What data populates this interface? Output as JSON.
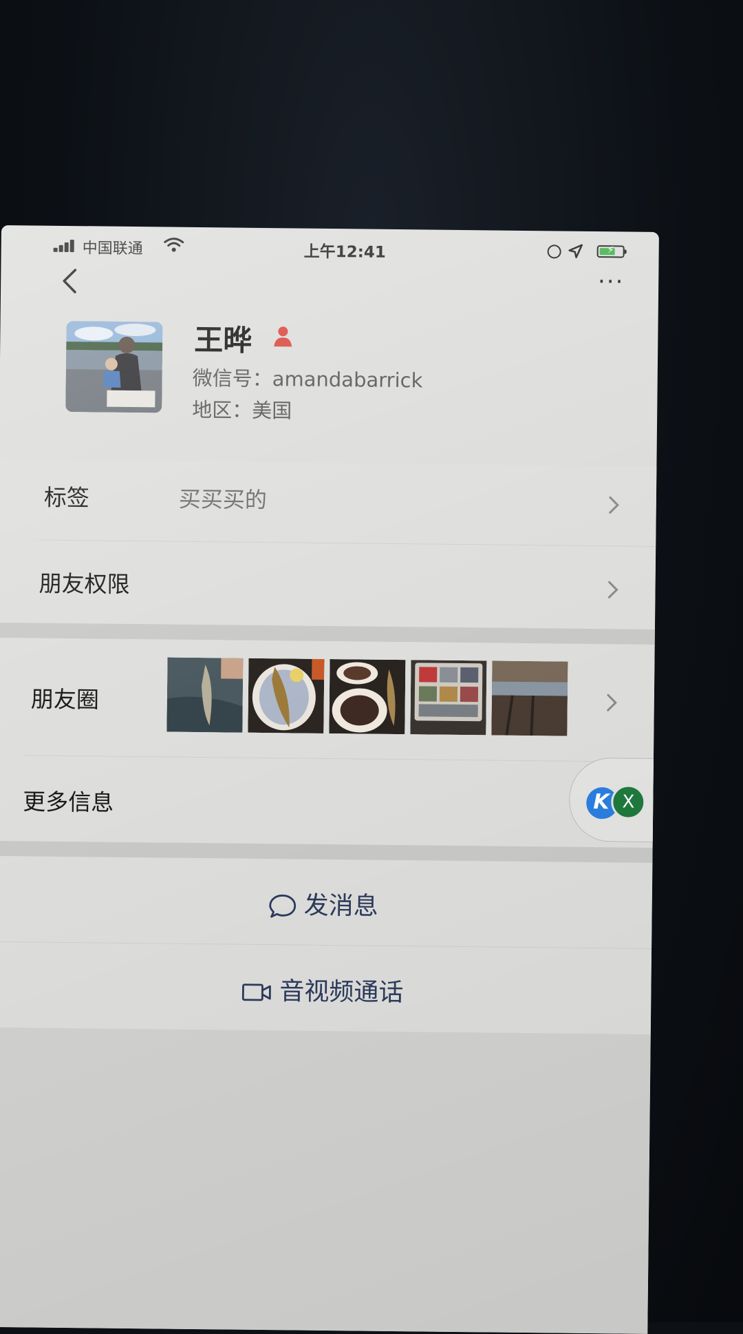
{
  "status_bar": {
    "carrier": "中国联通",
    "time": "上午12:41",
    "battery_level": 0.7
  },
  "nav": {
    "back_icon": "chevron-left-icon",
    "more_icon": "more-dots-icon",
    "more_text": "···"
  },
  "profile": {
    "name": "王晔",
    "wechat_id": "微信号：amandabarrick",
    "region": "地区：美国",
    "badge_icon": "contact-person-icon"
  },
  "rows": {
    "tags": {
      "label": "标签",
      "value": "买买买的"
    },
    "permissions": {
      "label": "朋友权限"
    },
    "moments": {
      "label": "朋友圈"
    },
    "more_info": {
      "label": "更多信息"
    }
  },
  "actions": {
    "send_message": {
      "label": "发消息",
      "icon": "chat-bubble-icon"
    },
    "av_call": {
      "label": "音视频通话",
      "icon": "video-camera-icon"
    }
  },
  "floating": {
    "app_letter": "K",
    "close_label": "X"
  },
  "colors": {
    "accent_text": "#2c3a5c",
    "badge_red": "#d9433b",
    "battery_green": "#3fb24a"
  }
}
